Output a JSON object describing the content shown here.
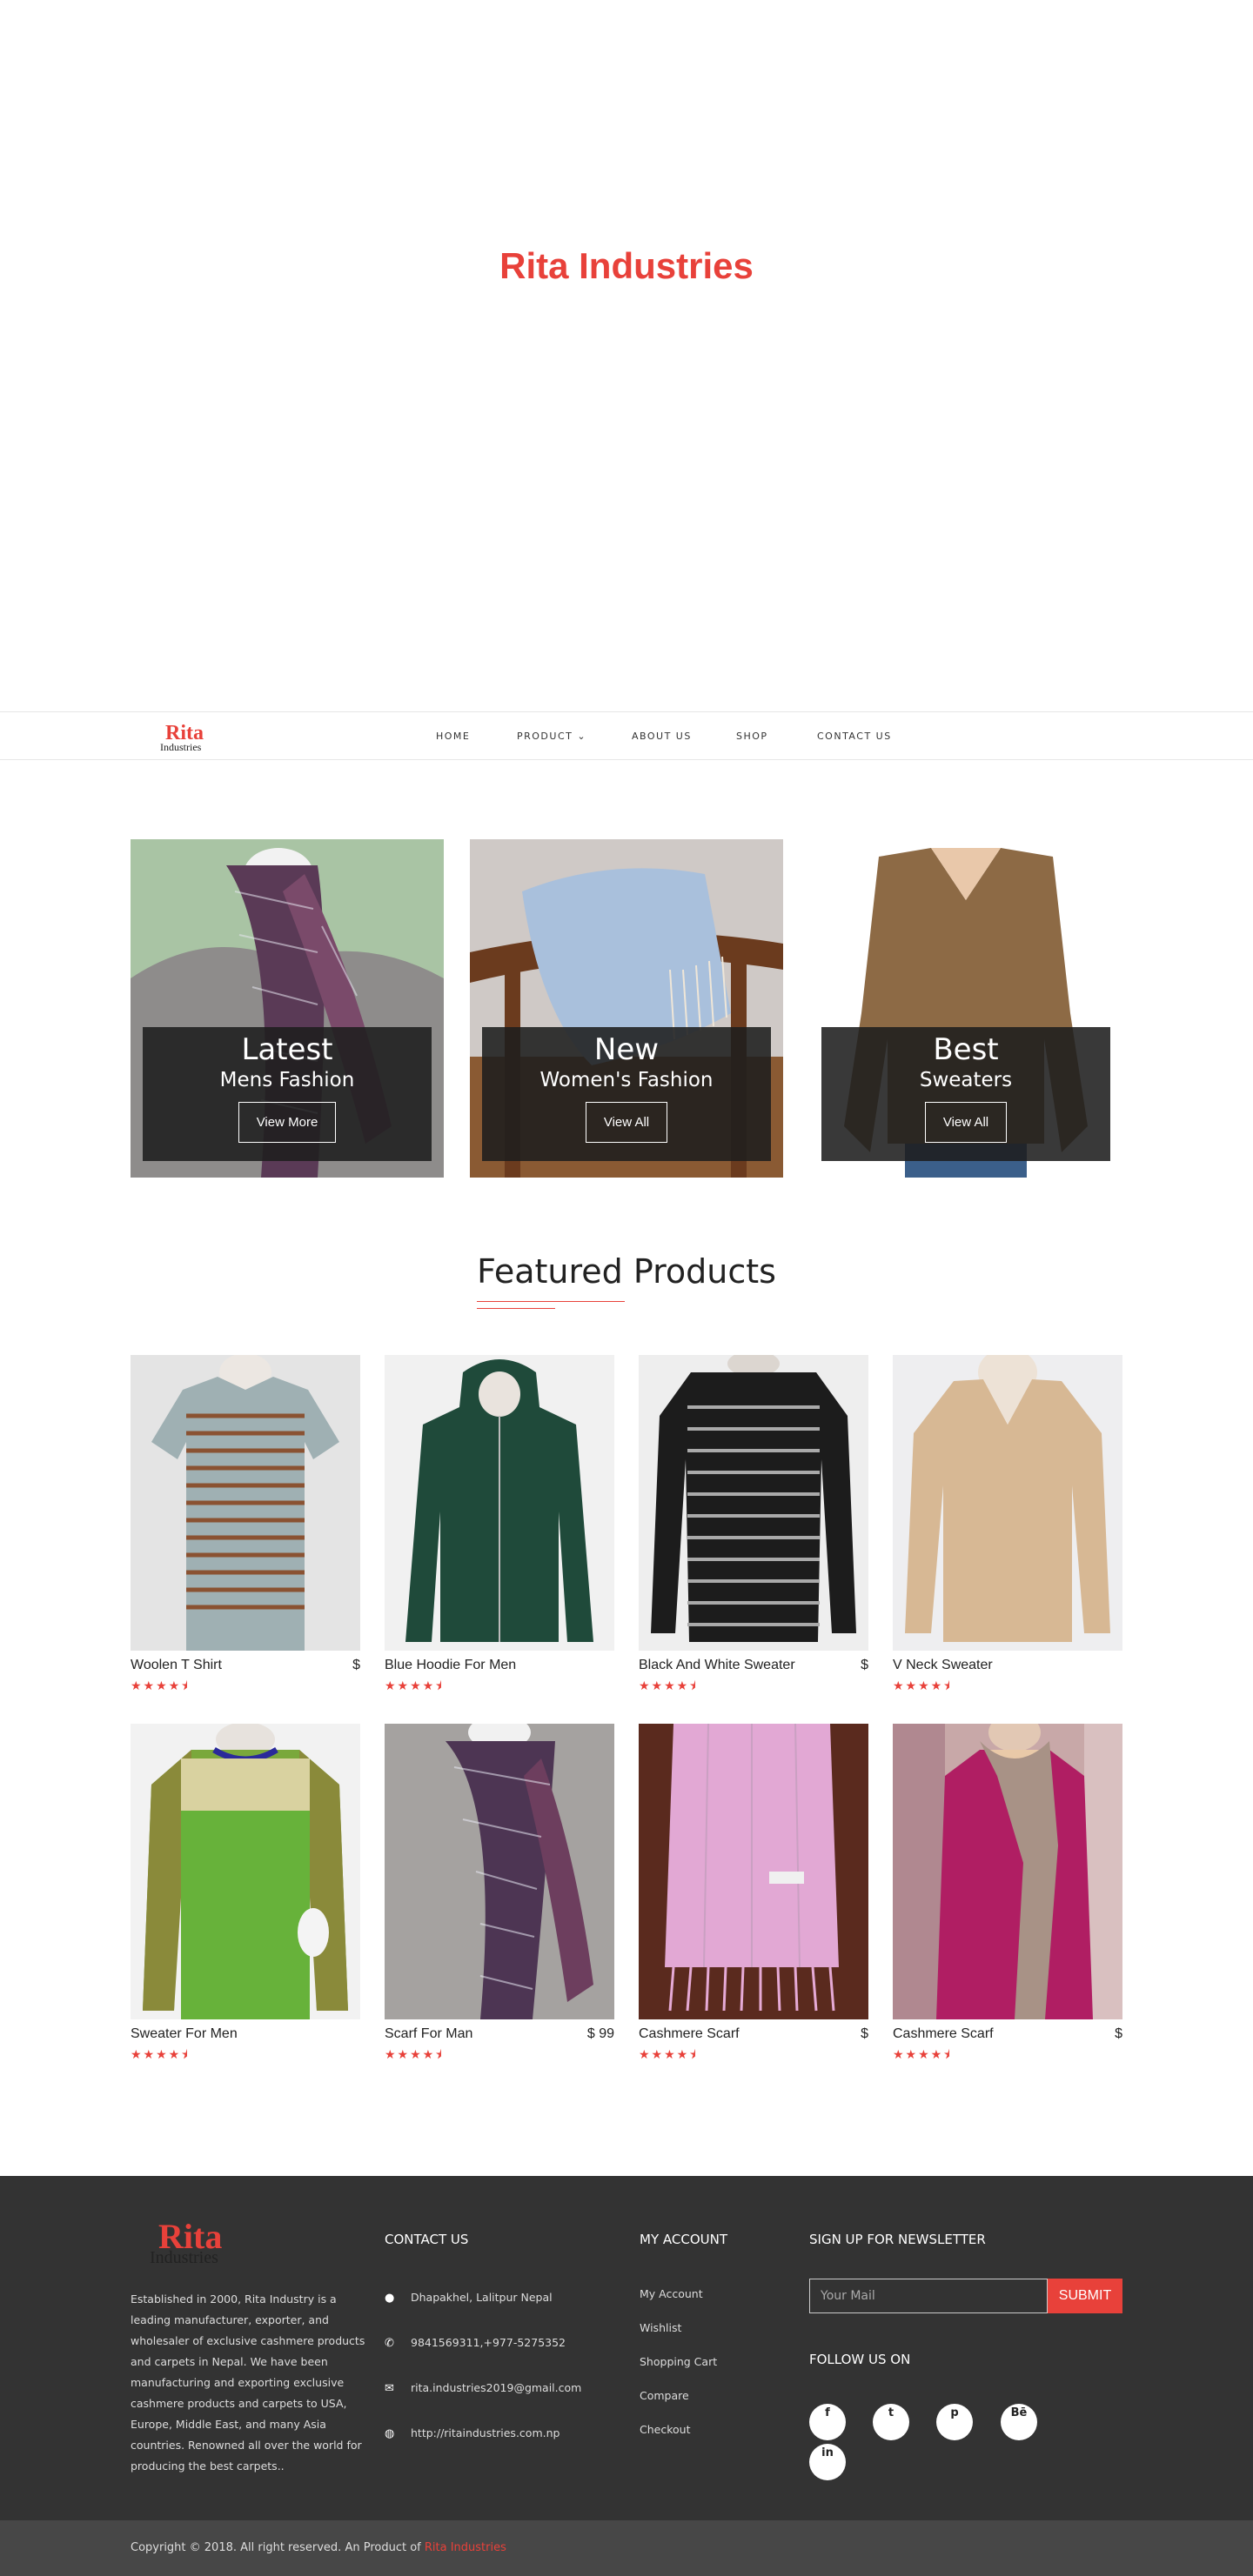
{
  "hero": {
    "title": "Rita Industries"
  },
  "brand": {
    "line1": "Rita",
    "line2": "Industries"
  },
  "nav": {
    "items": [
      {
        "label": "HOME"
      },
      {
        "label": "PRODUCT"
      },
      {
        "label": "ABOUT US"
      },
      {
        "label": "SHOP"
      },
      {
        "label": "CONTACT US"
      }
    ],
    "product_chevron": "⌄"
  },
  "banners": [
    {
      "big": "Latest",
      "small": "Mens Fashion",
      "button": "View More"
    },
    {
      "big": "New",
      "small": "Women's Fashion",
      "button": "View All"
    },
    {
      "big": "Best",
      "small": "Sweaters",
      "button": "View All"
    }
  ],
  "featured": {
    "title": "Featured Products",
    "products": [
      {
        "name": "Woolen T Shirt",
        "price": "$",
        "stars": "★★★★⯨"
      },
      {
        "name": "Blue Hoodie For Men",
        "price": "",
        "stars": "★★★★⯨"
      },
      {
        "name": "Black And White Sweater",
        "price": "$",
        "stars": "★★★★⯨"
      },
      {
        "name": "V Neck Sweater",
        "price": "",
        "stars": "★★★★⯨"
      },
      {
        "name": "Sweater For Men",
        "price": "",
        "stars": "★★★★⯨"
      },
      {
        "name": "Scarf For Man",
        "price": "$ 99",
        "stars": "★★★★⯨"
      },
      {
        "name": "Cashmere Scarf",
        "price": "$",
        "stars": "★★★★⯨"
      },
      {
        "name": "Cashmere Scarf",
        "price": "$",
        "stars": "★★★★⯨"
      }
    ]
  },
  "footer": {
    "about": "Established in 2000, Rita Industry is a leading manufacturer, exporter, and wholesaler of exclusive cashmere products and carpets in Nepal. We have been manufacturing and exporting exclusive cashmere products and carpets to USA, Europe, Middle East, and many Asia countries. Renowned all over the world for producing the best carpets..",
    "contact_heading": "CONTACT US",
    "contact": [
      {
        "icon": "●",
        "text": "Dhapakhel, Lalitpur Nepal"
      },
      {
        "icon": "✆",
        "text": "9841569311,+977-5275352"
      },
      {
        "icon": "✉",
        "text": "rita.industries2019@gmail.com"
      },
      {
        "icon": "◍",
        "text": "http://ritaindustries.com.np"
      }
    ],
    "account_heading": "MY ACCOUNT",
    "account_links": [
      "My Account",
      "Wishlist",
      "Shopping Cart",
      "Compare",
      "Checkout"
    ],
    "newsletter_heading": "SIGN UP FOR NEWSLETTER",
    "newsletter_placeholder": "Your Mail",
    "newsletter_button": "SUBMIT",
    "follow_heading": "FOLLOW US ON",
    "social": [
      "f",
      "t",
      "p",
      "Bē",
      "in"
    ]
  },
  "copyright": {
    "text": "Copyright © 2018. All right reserved. An Product of ",
    "brand": "Rita Industries"
  },
  "colors": {
    "accent": "#e8413a",
    "footer_bg": "#333333",
    "bottom_bg": "#474747"
  }
}
